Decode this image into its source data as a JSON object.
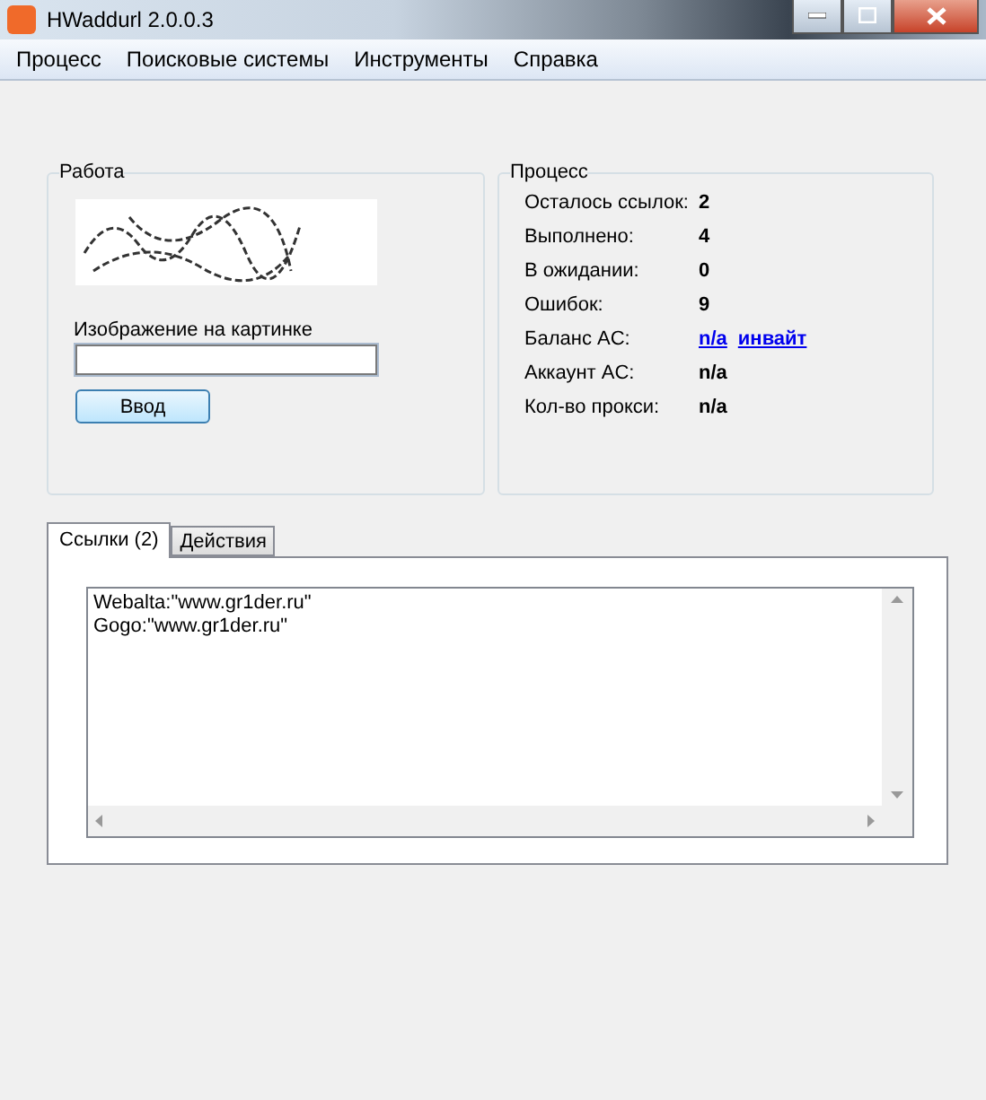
{
  "window": {
    "title": "HWaddurl 2.0.0.3"
  },
  "menu": [
    "Процесс",
    "Поисковые системы",
    "Инструменты",
    "Справка"
  ],
  "work": {
    "title": "Работа",
    "captcha_label": "Изображение на картинке",
    "submit": "Ввод"
  },
  "process": {
    "title": "Процесс",
    "rows": [
      {
        "label": "Осталось ссылок:",
        "values": [
          {
            "text": "2",
            "kind": "bold"
          }
        ]
      },
      {
        "label": "Выполнено:",
        "values": [
          {
            "text": "4",
            "kind": "bold"
          }
        ]
      },
      {
        "label": "В ожидании:",
        "values": [
          {
            "text": "0",
            "kind": "bold"
          }
        ]
      },
      {
        "label": "Ошибок:",
        "values": [
          {
            "text": "9",
            "kind": "bold"
          }
        ]
      },
      {
        "label": "Баланс AC:",
        "values": [
          {
            "text": "n/a",
            "kind": "link"
          },
          {
            "text": "инвайт",
            "kind": "link"
          }
        ]
      },
      {
        "label": "Аккаунт AC:",
        "values": [
          {
            "text": "n/a",
            "kind": "bold"
          }
        ]
      },
      {
        "label": "Кол-во прокси:",
        "values": [
          {
            "text": "n/a",
            "kind": "bold"
          }
        ]
      }
    ]
  },
  "tabs": [
    {
      "label": "Ссылки (2)",
      "selected": true
    },
    {
      "label": "Действия",
      "selected": false
    }
  ],
  "links_text": [
    "Webalta:\"www.gr1der.ru\"",
    "Gogo:\"www.gr1der.ru\""
  ]
}
